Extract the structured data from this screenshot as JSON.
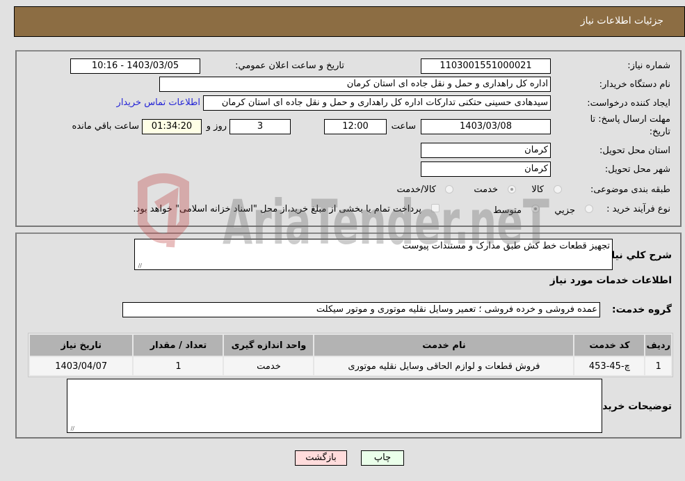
{
  "header": {
    "title": "جزئیات اطلاعات نیاز"
  },
  "details": {
    "need_number": {
      "label": "شماره نیاز:",
      "value": "1103001551000021"
    },
    "announce_datetime": {
      "label": "تاریخ و ساعت اعلان عمومي:",
      "value": "1403/03/05 - 10:16"
    },
    "buyer_org": {
      "label": "نام دستگاه خریدار:",
      "value": "اداره کل راهداری و حمل و نقل جاده ای استان کرمان"
    },
    "requester": {
      "label": "ایجاد کننده درخواست:",
      "value": "سیدهادی حسینی حتکنی تدارکات اداره کل راهداری و حمل و نقل جاده ای استان کرمان",
      "contact_link": "اطلاعات تماس خریدار"
    },
    "deadline": {
      "label_line1": "مهلت ارسال پاسخ: تا",
      "label_line2": "تاریخ:",
      "date": "1403/03/08",
      "time_label": "ساعت",
      "time": "12:00",
      "days": "3",
      "days_label": "روز و",
      "remaining": "01:34:20",
      "remaining_label": "ساعت باقي مانده"
    },
    "province": {
      "label": "استان محل تحویل:",
      "value": "کرمان"
    },
    "city": {
      "label": "شهر محل تحویل:",
      "value": "کرمان"
    },
    "category": {
      "label": "طبقه بندی موضوعی:",
      "options": [
        "کالا",
        "خدمت",
        "کالا/خدمت"
      ],
      "selected": "خدمت"
    },
    "purchase_type": {
      "label": "نوع فرآیند خرید :",
      "options": [
        "جزيي",
        "متوسط"
      ],
      "selected": "متوسط",
      "treasury_note": "پرداخت تمام یا بخشی از مبلغ خرید،از محل \"اسناد خزانه اسلامی\" خواهد بود."
    }
  },
  "description": {
    "label": "شرح کلي نیاز:",
    "value": "تجهیز قطعات خط کش طبق مدارک و مستندات پیوست"
  },
  "services": {
    "section_title": "اطلاعات خدمات مورد نیاز",
    "group_label": "گروه خدمت:",
    "group_value": "عمده فروشی و خرده فروشی ؛ تعمیر وسایل نقلیه موتوری و موتور سیکلت",
    "columns": [
      "ردیف",
      "کد خدمت",
      "نام خدمت",
      "واحد اندازه گیری",
      "تعداد / مقدار",
      "تاریخ نیاز"
    ],
    "rows": [
      [
        "1",
        "چ-45-453",
        "فروش قطعات و لوازم الحاقی وسایل نقلیه موتوری",
        "خدمت",
        "1",
        "1403/04/07"
      ]
    ]
  },
  "buyer_notes": {
    "label": "توضیحات خریدار:",
    "value": ""
  },
  "buttons": {
    "print": "چاپ",
    "back": "بازگشت"
  },
  "watermark": {
    "text": "AriaTender.neT"
  },
  "colors": {
    "header_bg": "#8c6d43",
    "print_bg": "#eaffea",
    "back_bg": "#ffdcdc",
    "link": "#2424d6"
  }
}
